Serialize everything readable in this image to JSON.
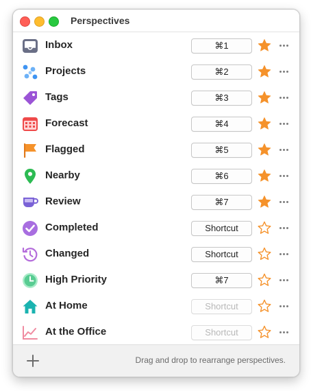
{
  "window": {
    "title": "Perspectives"
  },
  "perspectives": [
    {
      "label": "Inbox",
      "icon": "inbox-icon",
      "shortcut": "⌘1",
      "shortcut_is_placeholder": false,
      "favorite": true
    },
    {
      "label": "Projects",
      "icon": "projects-icon",
      "shortcut": "⌘2",
      "shortcut_is_placeholder": false,
      "favorite": true
    },
    {
      "label": "Tags",
      "icon": "tag-icon",
      "shortcut": "⌘3",
      "shortcut_is_placeholder": false,
      "favorite": true
    },
    {
      "label": "Forecast",
      "icon": "calendar-icon",
      "shortcut": "⌘4",
      "shortcut_is_placeholder": false,
      "favorite": true
    },
    {
      "label": "Flagged",
      "icon": "flag-icon",
      "shortcut": "⌘5",
      "shortcut_is_placeholder": false,
      "favorite": true
    },
    {
      "label": "Nearby",
      "icon": "location-pin-icon",
      "shortcut": "⌘6",
      "shortcut_is_placeholder": false,
      "favorite": true
    },
    {
      "label": "Review",
      "icon": "review-cup-icon",
      "shortcut": "⌘7",
      "shortcut_is_placeholder": false,
      "favorite": true
    },
    {
      "label": "Completed",
      "icon": "checkmark-circle-icon",
      "shortcut": "Shortcut",
      "shortcut_is_placeholder": false,
      "favorite": false
    },
    {
      "label": "Changed",
      "icon": "history-icon",
      "shortcut": "Shortcut",
      "shortcut_is_placeholder": false,
      "favorite": false
    },
    {
      "label": "High Priority",
      "icon": "clock-icon",
      "shortcut": "⌘7",
      "shortcut_is_placeholder": false,
      "favorite": false
    },
    {
      "label": "At Home",
      "icon": "house-icon",
      "shortcut": "Shortcut",
      "shortcut_is_placeholder": true,
      "favorite": false
    },
    {
      "label": "At the Office",
      "icon": "chart-line-icon",
      "shortcut": "Shortcut",
      "shortcut_is_placeholder": true,
      "favorite": false
    }
  ],
  "footer": {
    "add_icon": "plus-icon",
    "hint": "Drag and drop to rearrange perspectives."
  },
  "colors": {
    "star_orange": "#f5922b",
    "inbox": "#6a6f86",
    "projects": "#3f94f2",
    "tags": "#9b54d6",
    "forecast": "#ef4a4a",
    "flagged": "#f5922b",
    "nearby": "#2dbb53",
    "review": "#7a62d6",
    "completed": "#a86ee0",
    "changed": "#b46cdb",
    "high_priority": "#58cc92",
    "home": "#1bb3b0",
    "office": "#f08aa0"
  }
}
